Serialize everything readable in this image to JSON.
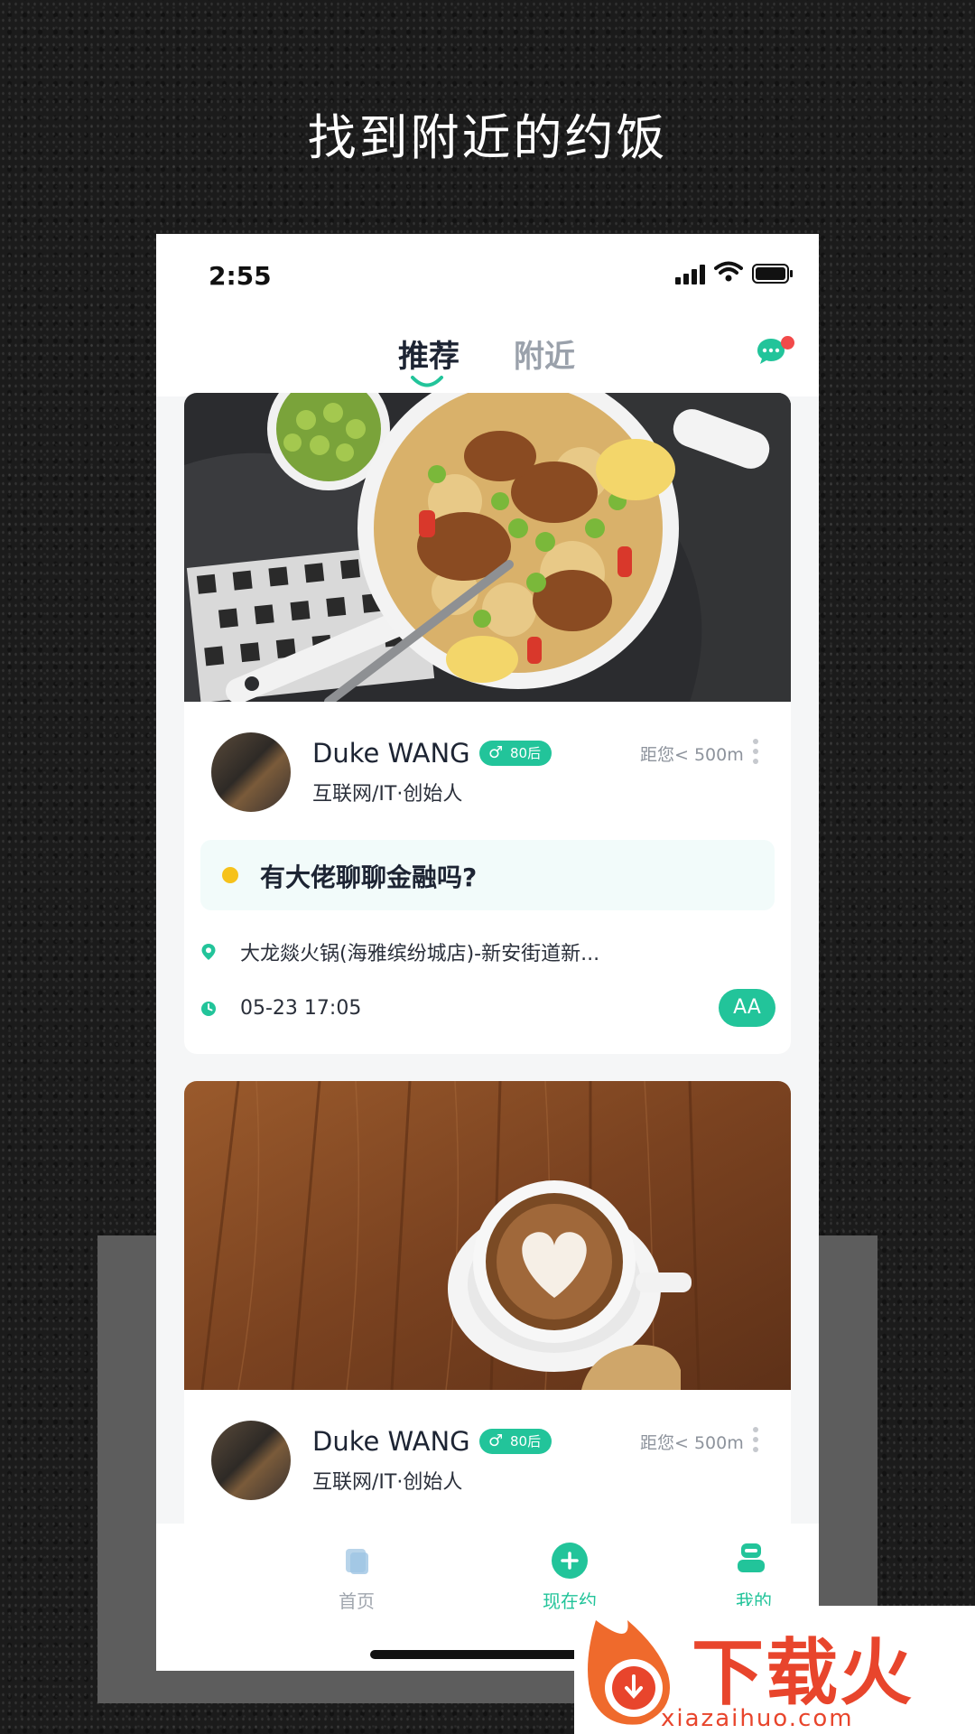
{
  "hero_title": "找到附近的约饭",
  "status": {
    "time": "2:55"
  },
  "header": {
    "tab_recommend": "推荐",
    "tab_nearby": "附近"
  },
  "cards": [
    {
      "name": "Duke WANG",
      "badge": "80后",
      "distance": "距您< 500m",
      "job": "互联网/IT·创始人",
      "topic": "有大佬聊聊金融吗?",
      "location": "大龙燚火锅(海雅缤纷城店)-新安街道新...",
      "datetime": "05-23 17:05",
      "pay_type": "AA"
    },
    {
      "name": "Duke WANG",
      "badge": "80后",
      "distance": "距您< 500m",
      "job": "互联网/IT·创始人"
    }
  ],
  "bottom_nav": {
    "home": "首页",
    "now": "现在约",
    "mine": "我的"
  },
  "watermark": {
    "text": "下载火",
    "url": "xiazaihuo.com"
  },
  "colors": {
    "accent": "#22c49a",
    "topic_dot": "#f6c21b",
    "notify": "#f24a4a"
  }
}
